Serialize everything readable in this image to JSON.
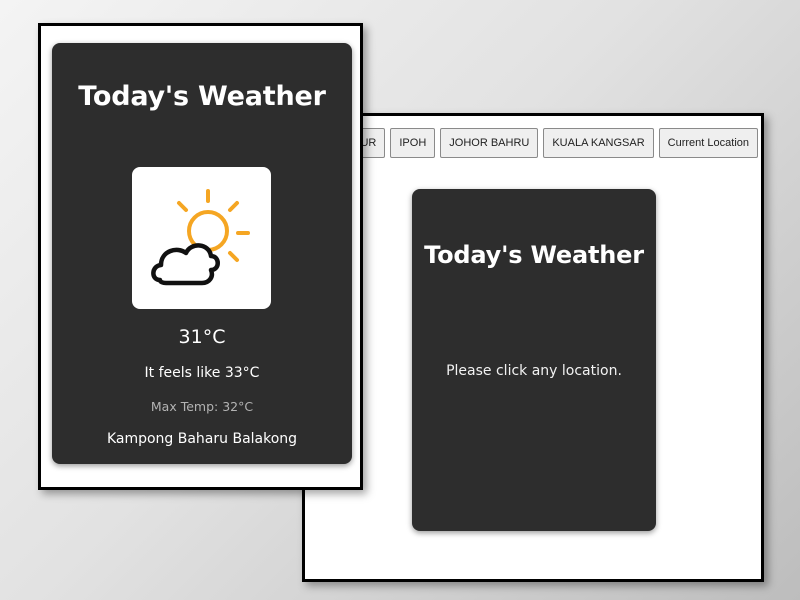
{
  "back_window": {
    "locations": [
      {
        "label": "UMPUR"
      },
      {
        "label": "IPOH"
      },
      {
        "label": "JOHOR BAHRU"
      },
      {
        "label": "KUALA KANGSAR"
      },
      {
        "label": "Current Location"
      }
    ],
    "card": {
      "title": "Today's Weather",
      "message": "Please click any location."
    }
  },
  "front_window": {
    "card": {
      "title": "Today's Weather",
      "icon": "partly-cloudy-sun-icon",
      "temperature": "31°C",
      "feels_like": "It feels like 33°C",
      "max_temp": "Max Temp: 32°C",
      "location": "Kampong Baharu Balakong"
    }
  },
  "colors": {
    "card_background": "#2d2d2d",
    "sun": "#f5a623",
    "cloud_outline": "#000000"
  }
}
